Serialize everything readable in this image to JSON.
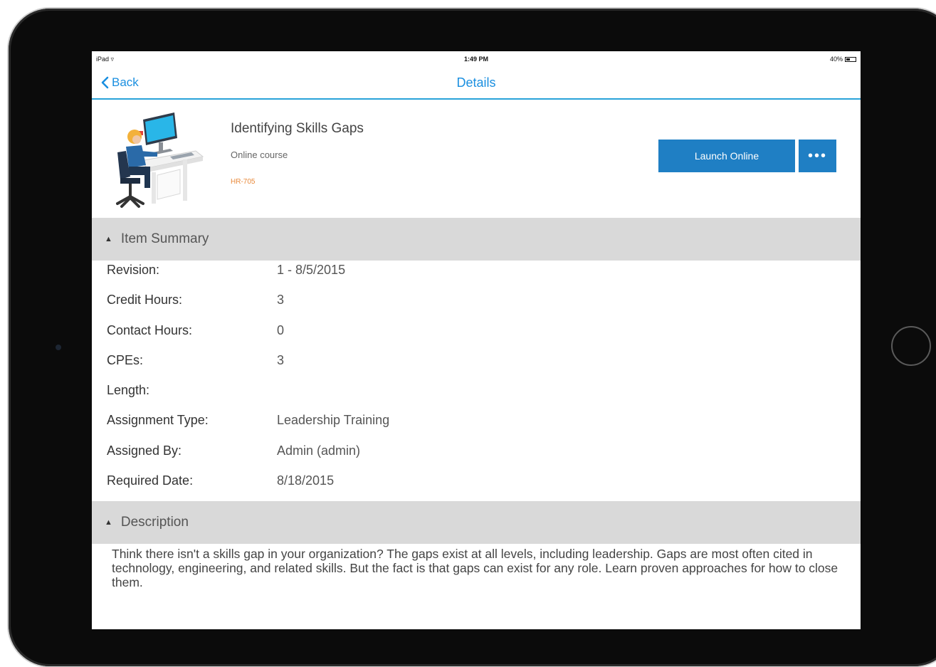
{
  "status_bar": {
    "device": "iPad",
    "time": "1:49 PM",
    "battery": "40%"
  },
  "nav": {
    "back_label": "Back",
    "title": "Details"
  },
  "course": {
    "title": "Identifying Skills Gaps",
    "type": "Online course",
    "code": "HR-705"
  },
  "actions": {
    "launch_label": "Launch Online",
    "more_label": "•••"
  },
  "item_summary": {
    "heading": "Item Summary",
    "rows": [
      {
        "label": "Revision:",
        "value": "1 - 8/5/2015"
      },
      {
        "label": "Credit Hours:",
        "value": "3"
      },
      {
        "label": "Contact Hours:",
        "value": "0"
      },
      {
        "label": "CPEs:",
        "value": "3"
      },
      {
        "label": "Length:",
        "value": ""
      },
      {
        "label": "Assignment Type:",
        "value": "Leadership Training"
      },
      {
        "label": "Assigned By:",
        "value": "Admin (admin)"
      },
      {
        "label": "Required Date:",
        "value": "8/18/2015"
      }
    ]
  },
  "description": {
    "heading": "Description",
    "text": "Think there isn't a skills gap in your organization? The gaps exist at all levels, including leadership. Gaps are most often cited in technology, engineering, and related skills. But the fact is that gaps can exist for any role. Learn proven approaches for how to close them."
  },
  "colors": {
    "accent": "#1f7fc4",
    "link": "#1a8fe0",
    "section_bg": "#d9d9d9",
    "code": "#e8893a"
  }
}
